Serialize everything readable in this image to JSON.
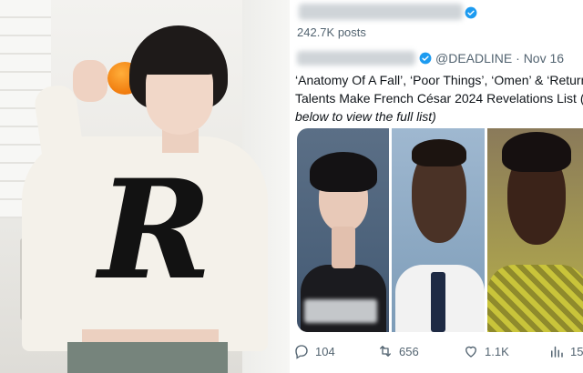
{
  "tweet": {
    "posts_count": "242.7K posts",
    "handle": "@DEADLINE",
    "separator": "·",
    "date": "Nov 16",
    "text_line1": "‘Anatomy Of A Fall’, ‘Poor Things’, ‘Omen’ & ‘Return",
    "text_line2": "Talents Make French César 2024 Revelations List (",
    "text_line3": "below to view the full list)"
  },
  "actions": {
    "replies": "104",
    "reposts": "656",
    "likes": "1.1K",
    "views": "15"
  },
  "colors": {
    "verified": "#1d9bf0",
    "meta_text": "#536471",
    "body_text": "#0f1419"
  },
  "icons": [
    "verified-badge-icon",
    "reply-icon",
    "repost-icon",
    "like-icon",
    "views-icon"
  ]
}
